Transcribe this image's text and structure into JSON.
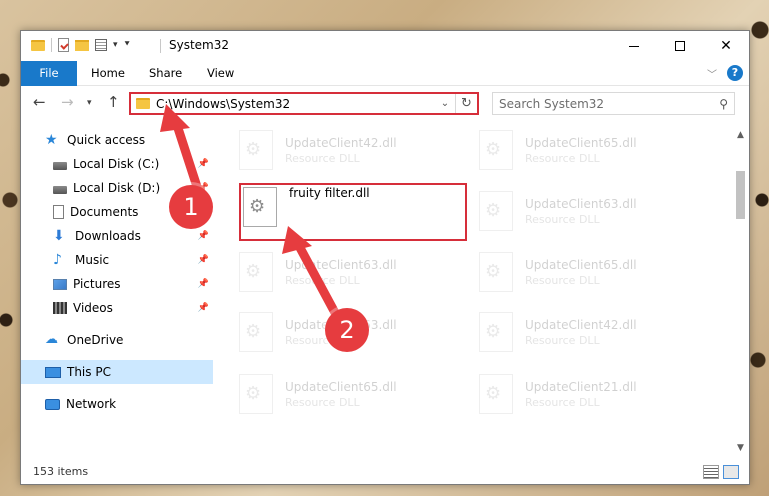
{
  "window": {
    "title": "System32",
    "controls": {
      "minimize": "–",
      "maximize": "□",
      "close": "✕"
    }
  },
  "ribbon": {
    "tabs": [
      "File",
      "Home",
      "Share",
      "View"
    ]
  },
  "navbar": {
    "address": "C:\\Windows\\System32",
    "search_placeholder": "Search System32"
  },
  "sidebar": {
    "items": [
      {
        "label": "Quick access",
        "icon": "star-icon",
        "pinned": false
      },
      {
        "label": "Local Disk (C:)",
        "icon": "disk-icon",
        "pinned": true
      },
      {
        "label": "Local Disk (D:)",
        "icon": "disk-icon",
        "pinned": true
      },
      {
        "label": "Documents",
        "icon": "documents-icon",
        "pinned": true
      },
      {
        "label": "Downloads",
        "icon": "downloads-icon",
        "pinned": true
      },
      {
        "label": "Music",
        "icon": "music-icon",
        "pinned": true
      },
      {
        "label": "Pictures",
        "icon": "pictures-icon",
        "pinned": true
      },
      {
        "label": "Videos",
        "icon": "videos-icon",
        "pinned": true
      },
      {
        "label": "OneDrive",
        "icon": "onedrive-icon",
        "pinned": false
      },
      {
        "label": "This PC",
        "icon": "this-pc-icon",
        "pinned": false,
        "selected": true
      },
      {
        "label": "Network",
        "icon": "network-icon",
        "pinned": false
      }
    ]
  },
  "files": [
    {
      "name": "UpdateClient42.dll",
      "type": "Resource DLL",
      "faded": true
    },
    {
      "name": "UpdateClient65.dll",
      "type": "Resource DLL",
      "faded": true
    },
    {
      "name": "fruity filter.dll",
      "type": "",
      "faded": false
    },
    {
      "name": "UpdateClient63.dll",
      "type": "Resource DLL",
      "faded": true
    },
    {
      "name": "UpdateClient63.dll",
      "type": "Resource DLL",
      "faded": true
    },
    {
      "name": "UpdateClient65.dll",
      "type": "Resource DLL",
      "faded": true
    },
    {
      "name": "UpdateClient63.dll",
      "type": "Resource DLL",
      "faded": true
    },
    {
      "name": "UpdateClient42.dll",
      "type": "Resource DLL",
      "faded": true
    },
    {
      "name": "UpdateClient65.dll",
      "type": "Resource DLL",
      "faded": true
    },
    {
      "name": "UpdateClient21.dll",
      "type": "Resource DLL",
      "faded": true
    }
  ],
  "status": {
    "item_count": "153 items"
  },
  "annotations": {
    "step1": "1",
    "step2": "2",
    "color": "#e63c3f"
  }
}
